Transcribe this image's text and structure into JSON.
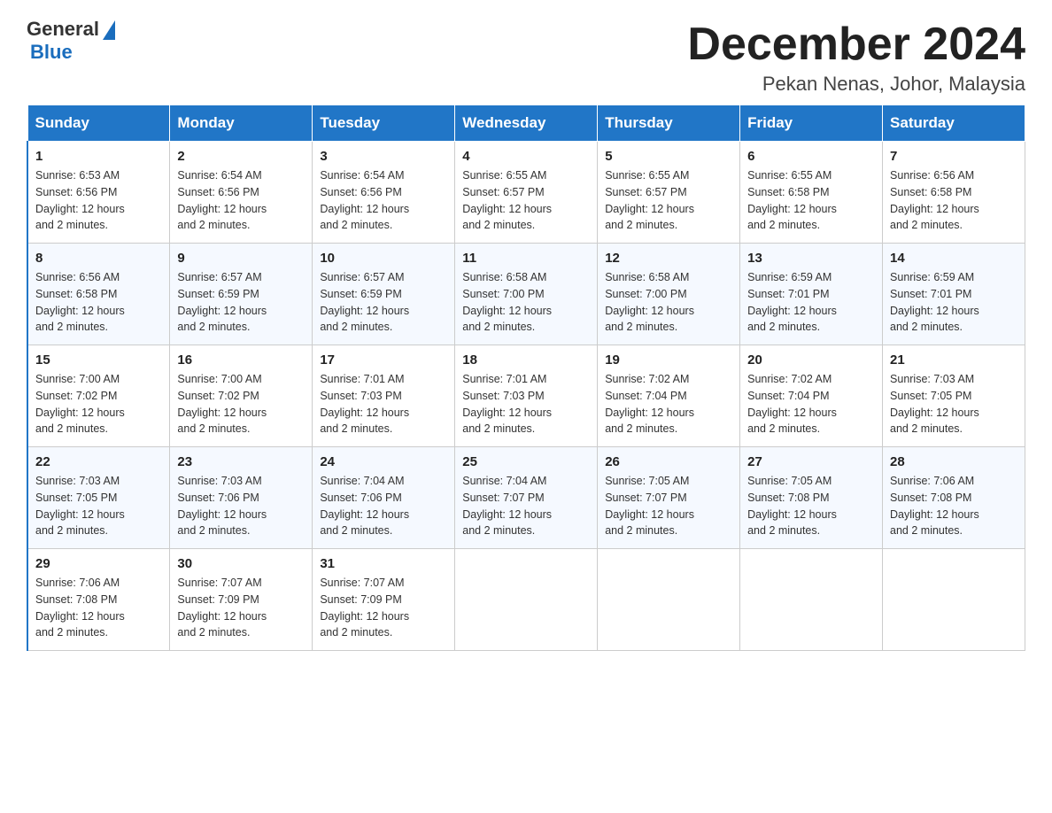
{
  "header": {
    "logo_general": "General",
    "logo_blue": "Blue",
    "month_title": "December 2024",
    "location": "Pekan Nenas, Johor, Malaysia"
  },
  "weekdays": [
    "Sunday",
    "Monday",
    "Tuesday",
    "Wednesday",
    "Thursday",
    "Friday",
    "Saturday"
  ],
  "weeks": [
    [
      {
        "day": "1",
        "sunrise": "6:53 AM",
        "sunset": "6:56 PM",
        "daylight": "12 hours and 2 minutes."
      },
      {
        "day": "2",
        "sunrise": "6:54 AM",
        "sunset": "6:56 PM",
        "daylight": "12 hours and 2 minutes."
      },
      {
        "day": "3",
        "sunrise": "6:54 AM",
        "sunset": "6:56 PM",
        "daylight": "12 hours and 2 minutes."
      },
      {
        "day": "4",
        "sunrise": "6:55 AM",
        "sunset": "6:57 PM",
        "daylight": "12 hours and 2 minutes."
      },
      {
        "day": "5",
        "sunrise": "6:55 AM",
        "sunset": "6:57 PM",
        "daylight": "12 hours and 2 minutes."
      },
      {
        "day": "6",
        "sunrise": "6:55 AM",
        "sunset": "6:58 PM",
        "daylight": "12 hours and 2 minutes."
      },
      {
        "day": "7",
        "sunrise": "6:56 AM",
        "sunset": "6:58 PM",
        "daylight": "12 hours and 2 minutes."
      }
    ],
    [
      {
        "day": "8",
        "sunrise": "6:56 AM",
        "sunset": "6:58 PM",
        "daylight": "12 hours and 2 minutes."
      },
      {
        "day": "9",
        "sunrise": "6:57 AM",
        "sunset": "6:59 PM",
        "daylight": "12 hours and 2 minutes."
      },
      {
        "day": "10",
        "sunrise": "6:57 AM",
        "sunset": "6:59 PM",
        "daylight": "12 hours and 2 minutes."
      },
      {
        "day": "11",
        "sunrise": "6:58 AM",
        "sunset": "7:00 PM",
        "daylight": "12 hours and 2 minutes."
      },
      {
        "day": "12",
        "sunrise": "6:58 AM",
        "sunset": "7:00 PM",
        "daylight": "12 hours and 2 minutes."
      },
      {
        "day": "13",
        "sunrise": "6:59 AM",
        "sunset": "7:01 PM",
        "daylight": "12 hours and 2 minutes."
      },
      {
        "day": "14",
        "sunrise": "6:59 AM",
        "sunset": "7:01 PM",
        "daylight": "12 hours and 2 minutes."
      }
    ],
    [
      {
        "day": "15",
        "sunrise": "7:00 AM",
        "sunset": "7:02 PM",
        "daylight": "12 hours and 2 minutes."
      },
      {
        "day": "16",
        "sunrise": "7:00 AM",
        "sunset": "7:02 PM",
        "daylight": "12 hours and 2 minutes."
      },
      {
        "day": "17",
        "sunrise": "7:01 AM",
        "sunset": "7:03 PM",
        "daylight": "12 hours and 2 minutes."
      },
      {
        "day": "18",
        "sunrise": "7:01 AM",
        "sunset": "7:03 PM",
        "daylight": "12 hours and 2 minutes."
      },
      {
        "day": "19",
        "sunrise": "7:02 AM",
        "sunset": "7:04 PM",
        "daylight": "12 hours and 2 minutes."
      },
      {
        "day": "20",
        "sunrise": "7:02 AM",
        "sunset": "7:04 PM",
        "daylight": "12 hours and 2 minutes."
      },
      {
        "day": "21",
        "sunrise": "7:03 AM",
        "sunset": "7:05 PM",
        "daylight": "12 hours and 2 minutes."
      }
    ],
    [
      {
        "day": "22",
        "sunrise": "7:03 AM",
        "sunset": "7:05 PM",
        "daylight": "12 hours and 2 minutes."
      },
      {
        "day": "23",
        "sunrise": "7:03 AM",
        "sunset": "7:06 PM",
        "daylight": "12 hours and 2 minutes."
      },
      {
        "day": "24",
        "sunrise": "7:04 AM",
        "sunset": "7:06 PM",
        "daylight": "12 hours and 2 minutes."
      },
      {
        "day": "25",
        "sunrise": "7:04 AM",
        "sunset": "7:07 PM",
        "daylight": "12 hours and 2 minutes."
      },
      {
        "day": "26",
        "sunrise": "7:05 AM",
        "sunset": "7:07 PM",
        "daylight": "12 hours and 2 minutes."
      },
      {
        "day": "27",
        "sunrise": "7:05 AM",
        "sunset": "7:08 PM",
        "daylight": "12 hours and 2 minutes."
      },
      {
        "day": "28",
        "sunrise": "7:06 AM",
        "sunset": "7:08 PM",
        "daylight": "12 hours and 2 minutes."
      }
    ],
    [
      {
        "day": "29",
        "sunrise": "7:06 AM",
        "sunset": "7:08 PM",
        "daylight": "12 hours and 2 minutes."
      },
      {
        "day": "30",
        "sunrise": "7:07 AM",
        "sunset": "7:09 PM",
        "daylight": "12 hours and 2 minutes."
      },
      {
        "day": "31",
        "sunrise": "7:07 AM",
        "sunset": "7:09 PM",
        "daylight": "12 hours and 2 minutes."
      },
      null,
      null,
      null,
      null
    ]
  ],
  "labels": {
    "sunrise": "Sunrise:",
    "sunset": "Sunset:",
    "daylight": "Daylight:"
  }
}
